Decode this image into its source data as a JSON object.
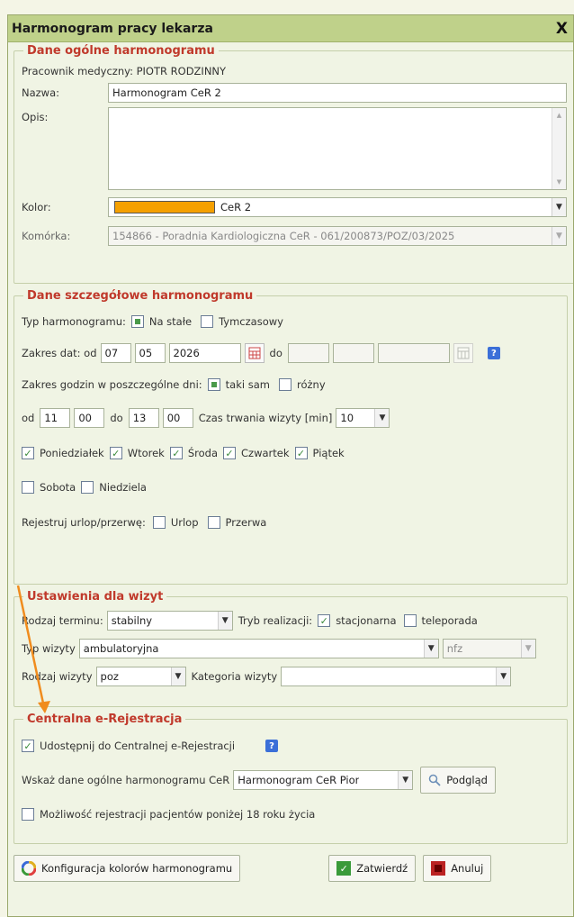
{
  "dialog": {
    "title": "Harmonogram pracy lekarza",
    "close": "X"
  },
  "general": {
    "legend": "Dane ogólne harmonogramu",
    "employee": "Pracownik medyczny: PIOTR RODZINNY",
    "name_label": "Nazwa:",
    "name_value": "Harmonogram CeR 2",
    "desc_label": "Opis:",
    "desc_value": "",
    "color_label": "Kolor:",
    "color_value": "CeR 2",
    "color_hex": "#f5a000",
    "unit_label": "Komórka:",
    "unit_value": "154866 - Poradnia Kardiologiczna CeR - 061/200873/POZ/03/2025"
  },
  "details": {
    "legend": "Dane szczegółowe harmonogramu",
    "type_label": "Typ harmonogramu:",
    "type_permanent": "Na stałe",
    "type_temporary": "Tymczasowy",
    "date_range_label": "Zakres dat: od",
    "date_from": {
      "day": "07",
      "month": "05",
      "year": "2026"
    },
    "date_to_label": "do",
    "date_to": {
      "day": "",
      "month": "",
      "year": ""
    },
    "hours_label": "Zakres godzin w poszczególne dni:",
    "hours_same": "taki sam",
    "hours_diff": "różny",
    "from_label": "od",
    "from_h": "11",
    "from_m": "00",
    "to_label": "do",
    "to_h": "13",
    "to_m": "00",
    "duration_label": "Czas trwania wizyty [min]",
    "duration_value": "10",
    "days": [
      "Poniedziałek",
      "Wtorek",
      "Środa",
      "Czwartek",
      "Piątek",
      "Sobota",
      "Niedziela"
    ],
    "leave_label": "Rejestruj urlop/przerwę:",
    "leave_vacation": "Urlop",
    "leave_break": "Przerwa"
  },
  "visits": {
    "legend": "Ustawienia dla wizyt",
    "term_label": "Rodzaj terminu:",
    "term_value": "stabilny",
    "mode_label": "Tryb realizacji:",
    "mode_stationary": "stacjonarna",
    "mode_tele": "teleporada",
    "visit_type_label": "Typ wizyty",
    "visit_type_value": "ambulatoryjna",
    "nfz_value": "nfz",
    "kind_label": "Rodzaj wizyty",
    "kind_value": "poz",
    "category_label": "Kategoria wizyty",
    "category_value": ""
  },
  "central": {
    "legend": "Centralna e-Rejestracja",
    "share_label": "Udostępnij do Centralnej e-Rejestracji",
    "schedule_label": "Wskaż dane ogólne harmonogramu CeR",
    "schedule_value": "Harmonogram CeR Pior",
    "preview_label": "Podgląd",
    "minors_label": "Możliwość rejestracji pacjentów poniżej 18 roku życia"
  },
  "footer": {
    "colors_config": "Konfiguracja kolorów harmonogramu",
    "confirm": "Zatwierdź",
    "cancel": "Anuluj"
  },
  "icons": {
    "check": "✓",
    "dropdown": "▼",
    "help": "?",
    "arrow_color": "#f08c1e"
  }
}
